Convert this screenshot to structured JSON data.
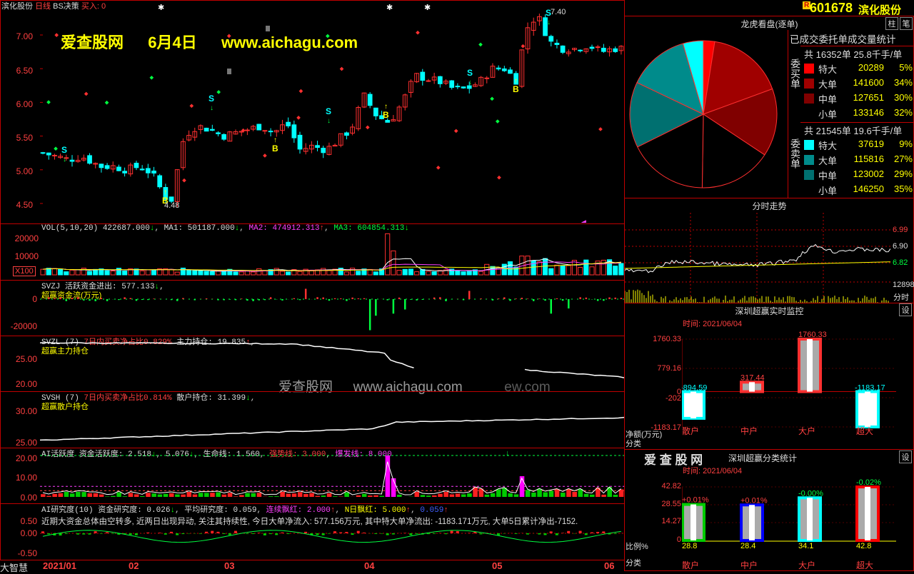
{
  "stock": {
    "code": "601678",
    "name": "滨化股份",
    "badge": "R"
  },
  "main": {
    "title_name": "滨化股份",
    "period": "日线",
    "indicator": "BS决策",
    "buy_label": "买入:",
    "buy_value": "0",
    "watermark_site": "爱查股网",
    "watermark_date": "6月4日",
    "watermark_url": "www.aichagu.com",
    "y_ticks": [
      "7.00",
      "6.50",
      "6.00",
      "5.50",
      "5.00",
      "4.50"
    ],
    "high_label": "7.40",
    "low_label": "4.48",
    "markers": [
      "S",
      "S",
      "S",
      "S",
      "S",
      "B",
      "B",
      "B",
      "B"
    ]
  },
  "vol": {
    "header": "VOL(5,10,20)",
    "value": "422687.000",
    "ma1": "MA1: 501187.000",
    "ma2": "MA2: 474912.313",
    "ma3": "MA3: 604854.313",
    "y_ticks": [
      "20000",
      "10000"
    ],
    "unit": "X100"
  },
  "svzj": {
    "header": "SVZJ",
    "title": "活跃资金进出:",
    "value": "577.133",
    "sub": "超赢资金流(万元)",
    "y_ticks": [
      "0",
      "-20000"
    ]
  },
  "svzl": {
    "header": "SVZL (7)",
    "ratio": "7日内买卖净占比0.829%",
    "title": "主力持仓:",
    "value": "19.835",
    "sub": "超赢主力持仓",
    "y_ticks": [
      "25.00",
      "20.00"
    ],
    "watermark_site": "爱查股网",
    "watermark_url": "www.aichagu.com",
    "watermark_tail": "ew.com"
  },
  "svsh": {
    "header": "SVSH (7)",
    "ratio": "7日内买卖净占比0.814%",
    "title": "散户持仓:",
    "value": "31.399",
    "sub": "超赢散户持仓",
    "y_ticks": [
      "30.00",
      "25.00"
    ]
  },
  "ai_active": {
    "header": "AI活跃度",
    "t1": "资金活跃度: 2.518",
    "t2": "5.076",
    "t3": "生命线: 1.560",
    "t4": "强势线: 3.000",
    "t5": "爆发线: 8.000",
    "y_ticks": [
      "20.00",
      "10.00",
      "0.00"
    ]
  },
  "ai_research": {
    "header": "AI研究度(10)",
    "t1": "资金研究度: 0.026",
    "t2": "平均研究度: 0.059",
    "t3": "连续飘红: 2.000",
    "t4": "N日飘红: 5.000",
    "t5": "0.059",
    "comment": "近期大资金总体由空转多, 近两日出现异动, 关注其持续性, 今日大单净流入: 577.156万元, 其中特大单净流出: -1183.171万元, 大单5日累计净出-7152.",
    "y_ticks": [
      "0.50",
      "0.00",
      "-0.50"
    ]
  },
  "xaxis": {
    "labels": [
      "2021/01",
      "02",
      "03",
      "04",
      "05",
      "06"
    ],
    "brand": "大智慧"
  },
  "dragon": {
    "title": "龙虎看盘(逐单)",
    "tab1": "柱",
    "tab2": "笔",
    "table_title": "已成交委托单成交量统计",
    "buy_label": "委买单",
    "sell_label": "委卖单",
    "buy_total": "共 16352单 25.8千手/单",
    "sell_total": "共 21545单 19.6千手/单",
    "buy_rows": [
      {
        "name": "特大",
        "value": "20289",
        "pct": "5%",
        "color": "#ff0000"
      },
      {
        "name": "大单",
        "value": "141600",
        "pct": "34%",
        "color": "#a00000"
      },
      {
        "name": "中单",
        "value": "127651",
        "pct": "30%",
        "color": "#800000"
      },
      {
        "name": "小单",
        "value": "133146",
        "pct": "32%",
        "color": "#000000"
      }
    ],
    "sell_rows": [
      {
        "name": "特大",
        "value": "37619",
        "pct": "9%",
        "color": "#00ffff"
      },
      {
        "name": "大单",
        "value": "115816",
        "pct": "27%",
        "color": "#008b8b"
      },
      {
        "name": "中单",
        "value": "123002",
        "pct": "29%",
        "color": "#007070"
      },
      {
        "name": "小单",
        "value": "146250",
        "pct": "35%",
        "color": "#000000"
      }
    ]
  },
  "minute": {
    "title": "分时走势",
    "prices": [
      "6.99",
      "6.90",
      "6.82"
    ],
    "vol": "12898",
    "vol_unit": "分时"
  },
  "realtime": {
    "title": "深圳超赢实时监控",
    "btn": "设",
    "time": "时间: 2021/06/04",
    "y_ticks": [
      "1760.33",
      "779.16",
      "0",
      "-202",
      "-1183.17"
    ],
    "ylabel": "净额(万元)",
    "xlabel": "分类",
    "categories": [
      "散户",
      "中户",
      "大户",
      "超大"
    ],
    "values": [
      -894.59,
      317.44,
      1760.33,
      -1183.17
    ],
    "value_labels": [
      "-894.59",
      "317.44",
      "1760.33",
      "-1183.17"
    ]
  },
  "classify": {
    "title": "深圳超赢分类统计",
    "logo": "爱 查 股 网",
    "btn": "设",
    "time": "时间: 2021/06/04",
    "y_ticks": [
      "42.82",
      "28.55",
      "14.27",
      "0"
    ],
    "ylabel": "比例%",
    "xlabel": "分类",
    "categories": [
      "散户",
      "中户",
      "大户",
      "超大"
    ],
    "values": [
      28.8,
      28.4,
      34.1,
      42.8
    ],
    "value_labels": [
      "28.8",
      "28.4",
      "34.1",
      "42.8"
    ],
    "change_labels": [
      "+0.01%",
      "+0.01%",
      "-0.00%",
      "-0.02%"
    ],
    "colors": [
      "#00cc00",
      "#0000ff",
      "#00ffff",
      "#ff0000"
    ]
  },
  "colors": {
    "up": "#ff3030",
    "down": "#00ffff",
    "grid": "#c00000",
    "yellow": "#ffff00"
  }
}
